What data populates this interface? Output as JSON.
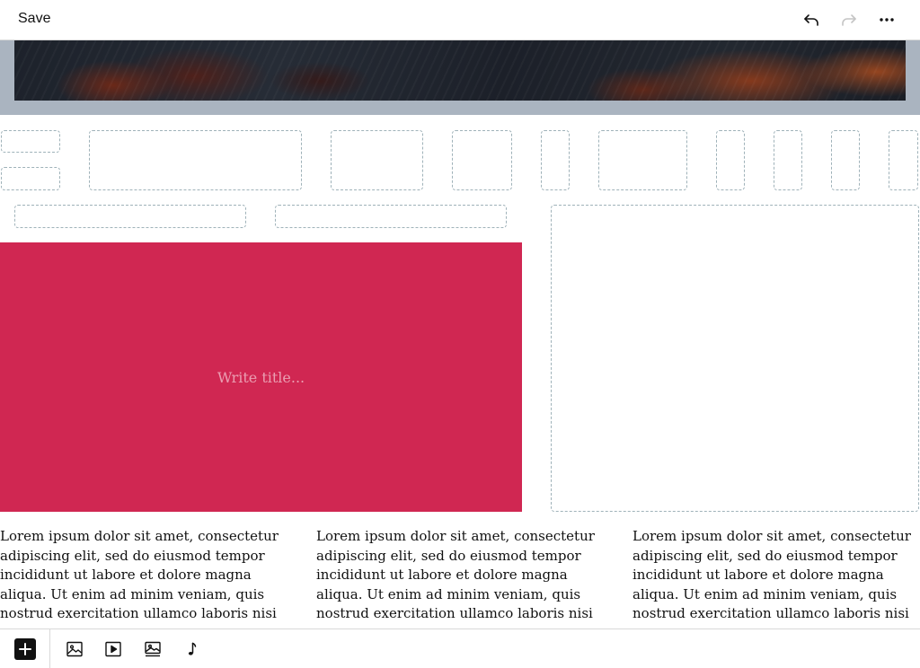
{
  "toolbar": {
    "save_label": "Save",
    "icons": [
      "undo-icon",
      "redo-icon",
      "more-icon"
    ]
  },
  "editor": {
    "title_placeholder": "Write title...",
    "title_block_color": "#d02752",
    "columns": [
      "Lorem ipsum dolor sit amet, consectetur adipiscing elit, sed do eiusmod tempor incididunt ut labore et dolore magna aliqua. Ut enim ad minim veniam, quis nostrud exercitation ullamco laboris nisi",
      "Lorem ipsum dolor sit amet, consectetur adipiscing elit, sed do eiusmod tempor incididunt ut labore et dolore magna aliqua. Ut enim ad minim veniam, quis nostrud exercitation ullamco laboris nisi",
      "Lorem ipsum dolor sit amet, consectetur adipiscing elit, sed do eiusmod tempor incididunt ut labore et dolore magna aliqua. Ut enim ad minim veniam, quis nostrud exercitation ullamco laboris nisi"
    ]
  },
  "bottom_toolbar": {
    "icons": [
      "add-icon",
      "image-icon",
      "video-icon",
      "gallery-icon",
      "audio-icon"
    ]
  },
  "colors": {
    "accent": "#d02752",
    "hero_band": "#aab4c0",
    "placeholder_border": "#9fb2b9"
  }
}
